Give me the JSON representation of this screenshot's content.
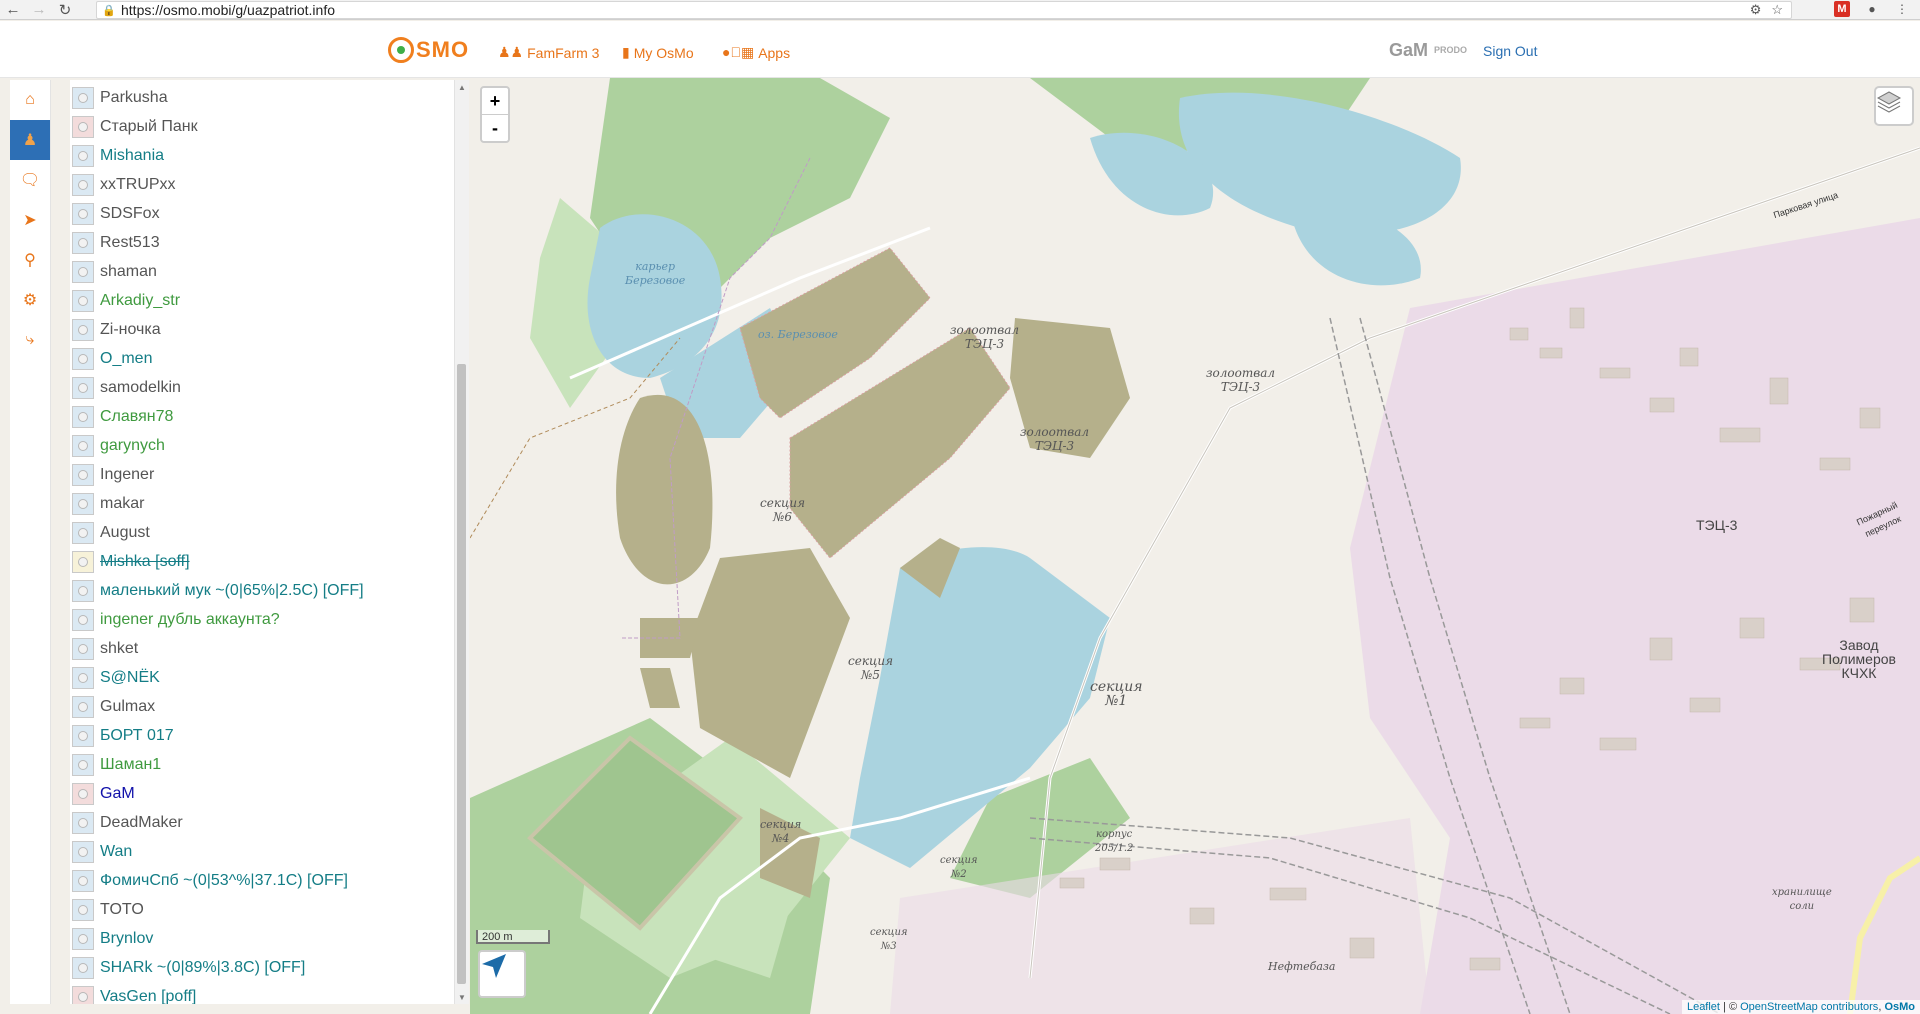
{
  "browser": {
    "url": "https://osmo.mobi/g/uazpatriot.info"
  },
  "header": {
    "logo_text": "SMO",
    "links": [
      {
        "label": "FamFarm 3",
        "icon": "users-icon"
      },
      {
        "label": "My OsMo",
        "icon": "map-icon"
      },
      {
        "label": "Apps",
        "icon": "apps-icon"
      }
    ],
    "user_name": "GaM",
    "user_badge": "PRODO",
    "sign_out": "Sign Out"
  },
  "rail": {
    "items": [
      {
        "icon": "home-icon",
        "active": false
      },
      {
        "icon": "users-icon",
        "active": true
      },
      {
        "icon": "chat-icon",
        "active": false
      },
      {
        "icon": "navigation-icon",
        "active": false
      },
      {
        "icon": "marker-icon",
        "active": false
      },
      {
        "icon": "gear-icon",
        "active": false
      },
      {
        "icon": "share-icon",
        "active": false
      }
    ]
  },
  "users": [
    {
      "name": "Parkusha",
      "color": "gray",
      "box": "blue"
    },
    {
      "name": "Старый Панк",
      "color": "gray",
      "box": "red"
    },
    {
      "name": "Mishania",
      "color": "teal",
      "box": "blue"
    },
    {
      "name": "xxTRUPxx",
      "color": "gray",
      "box": "blue"
    },
    {
      "name": "SDSFox",
      "color": "gray",
      "box": "blue"
    },
    {
      "name": "Rest513",
      "color": "gray",
      "box": "blue"
    },
    {
      "name": "shaman",
      "color": "gray",
      "box": "blue"
    },
    {
      "name": "Arkadiy_str",
      "color": "green",
      "box": "blue"
    },
    {
      "name": "Zi-ночка",
      "color": "gray",
      "box": "blue"
    },
    {
      "name": "O_men",
      "color": "teal",
      "box": "blue"
    },
    {
      "name": "samodelkin",
      "color": "gray",
      "box": "blue"
    },
    {
      "name": "Славян78",
      "color": "green",
      "box": "blue"
    },
    {
      "name": "garynych",
      "color": "green",
      "box": "blue"
    },
    {
      "name": "Ingener",
      "color": "gray",
      "box": "blue"
    },
    {
      "name": "makar",
      "color": "gray",
      "box": "blue"
    },
    {
      "name": "August",
      "color": "gray",
      "box": "blue"
    },
    {
      "name": "Mishka [soff]",
      "color": "tealstrike",
      "box": "yellow"
    },
    {
      "name": "маленький мук ~(0|65%|2.5C) [OFF]",
      "color": "teal",
      "box": "blue"
    },
    {
      "name": "ingener дубль аккаунта?",
      "color": "green",
      "box": "blue"
    },
    {
      "name": "shket",
      "color": "gray",
      "box": "blue"
    },
    {
      "name": "S@NЁK",
      "color": "teal",
      "box": "blue"
    },
    {
      "name": "Gulmax",
      "color": "gray",
      "box": "blue"
    },
    {
      "name": "БОРТ 017",
      "color": "teal",
      "box": "blue"
    },
    {
      "name": "Шаман1",
      "color": "green",
      "box": "blue"
    },
    {
      "name": "GaM",
      "color": "blue",
      "box": "red"
    },
    {
      "name": "DeadMaker",
      "color": "gray",
      "box": "blue"
    },
    {
      "name": "Wan",
      "color": "teal",
      "box": "blue"
    },
    {
      "name": "ФомичСпб ~(0|53^%|37.1C) [OFF]",
      "color": "teal",
      "box": "blue"
    },
    {
      "name": "TOTO",
      "color": "gray",
      "box": "blue"
    },
    {
      "name": "Brynlov",
      "color": "teal",
      "box": "blue"
    },
    {
      "name": "SHARk ~(0|89%|3.8C) [OFF]",
      "color": "teal",
      "box": "blue"
    },
    {
      "name": "VasGen [poff]",
      "color": "teal",
      "box": "red"
    }
  ],
  "map": {
    "zoom_in": "+",
    "zoom_out": "-",
    "scale_label": "200 m",
    "attribution_leaflet": "Leaflet",
    "attribution_sep": " | © ",
    "attribution_osm": "OpenStreetMap contributors",
    "attribution_comma": ", ",
    "attribution_osmo": "OsMo",
    "labels": {
      "karier": "карьер\nБерезовое",
      "berezovoe": "оз. Березовое",
      "zolo1": "золоотвал\nТЭЦ-3",
      "zolo2": "золоотвал\nТЭЦ-3",
      "zolo3": "золоотвал\nТЭЦ-3",
      "sek6": "секция\n№6",
      "sek5": "секция\n№5",
      "sek1": "секция\n№1",
      "sek4": "секция\n№4",
      "sek2": "секция\n№2",
      "sek3": "секция\n№3",
      "korpus": "корпус\n205/1.2",
      "tec3": "ТЭЦ-3",
      "zavod": "Завод\nПолимеров\nКЧХК",
      "neftebaza": "Нефтебаза",
      "hranilishe": "хранилище\nсоли",
      "parkovaya": "Парковая улица",
      "pozharny": "Пожарный переулок"
    }
  }
}
